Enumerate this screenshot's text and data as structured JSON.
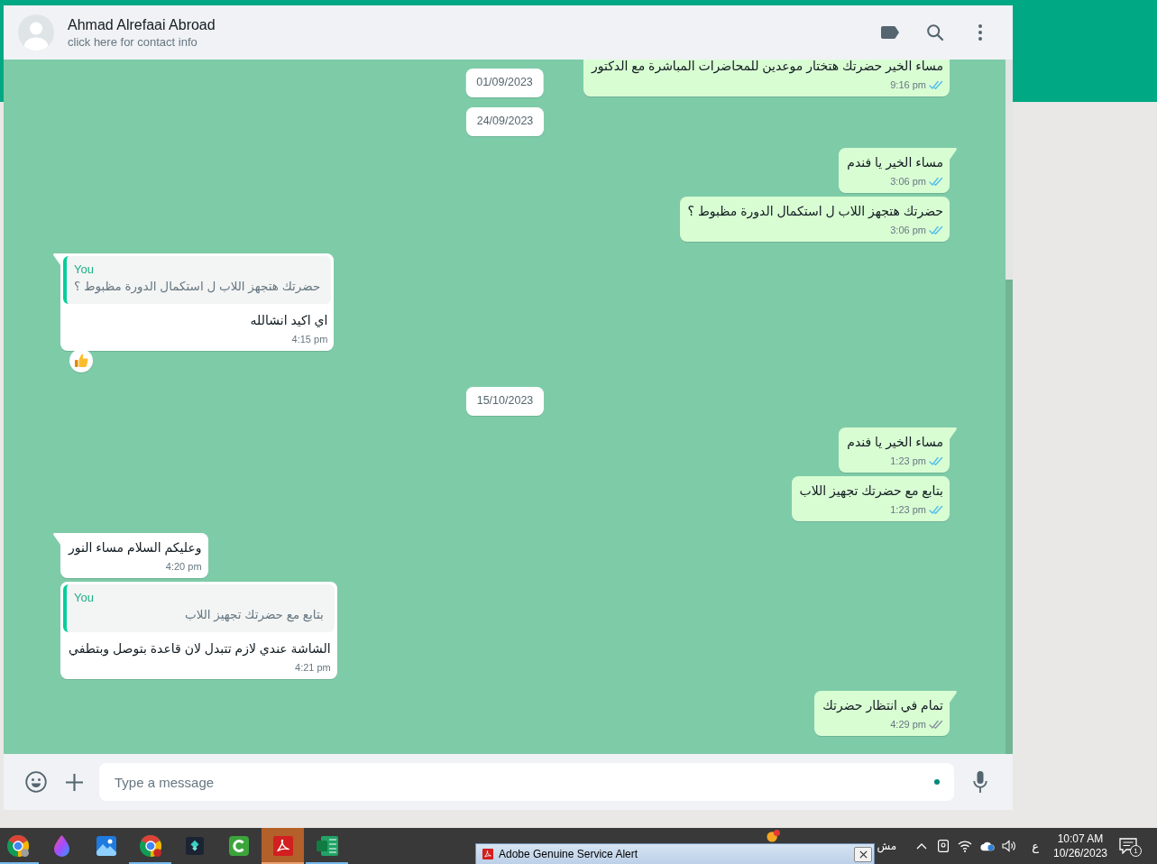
{
  "header": {
    "name": "Ahmad Alrefaai Abroad",
    "subtitle": "click here for contact info"
  },
  "chat": {
    "floating_date": "01/09/2023",
    "timeline": [
      {
        "kind": "outgoing",
        "tail": false,
        "text": "مساء الخير حضرتك هتختار موعدين للمحاضرات المباشرة مع الدكتور",
        "time": "9:16 pm",
        "read": true,
        "reaction": false
      },
      {
        "kind": "date",
        "text": "24/09/2023"
      },
      {
        "kind": "outgoing",
        "tail": true,
        "text": "مساء الخير يا فندم",
        "time": "3:06 pm",
        "read": true,
        "reaction": false
      },
      {
        "kind": "outgoing",
        "tail": false,
        "text": "حضرتك هتجهز اللاب ل استكمال الدورة مظبوط ؟",
        "time": "3:06 pm",
        "read": true,
        "reaction": false
      },
      {
        "kind": "incoming",
        "tail": true,
        "quote": {
          "author": "You",
          "text": "حضرتك هتجهز اللاب ل استكمال الدورة مظبوط ؟"
        },
        "text": "اي اكيد انشالله",
        "time": "4:15 pm",
        "reaction": true
      },
      {
        "kind": "date",
        "text": "15/10/2023"
      },
      {
        "kind": "outgoing",
        "tail": true,
        "text": "مساء الخير يا فندم",
        "time": "1:23 pm",
        "read": true,
        "reaction": false
      },
      {
        "kind": "outgoing",
        "tail": false,
        "text": "بتابع مع حضرتك تجهيز اللاب",
        "time": "1:23 pm",
        "read": true,
        "reaction": false
      },
      {
        "kind": "incoming",
        "tail": true,
        "text": "وعليكم السلام مساء النور",
        "time": "4:20 pm",
        "reaction": false
      },
      {
        "kind": "incoming",
        "tail": false,
        "quote": {
          "author": "You",
          "text": "بتابع مع حضرتك تجهيز اللاب"
        },
        "text": "الشاشة عندي لازم تتبدل لان قاعدة بتوصل وبتطفي",
        "time": "4:21 pm",
        "reaction": false
      },
      {
        "kind": "outgoing",
        "tail": true,
        "text": "تمام في انتظار حضرتك",
        "time": "4:29 pm",
        "read": false,
        "reaction": false
      }
    ]
  },
  "composer": {
    "placeholder": "Type a message"
  },
  "taskbar": {
    "apps": [
      {
        "kind": "browser",
        "running": true,
        "attention": false
      },
      {
        "kind": "drop",
        "running": false,
        "attention": false
      },
      {
        "kind": "photos",
        "running": false,
        "attention": false
      },
      {
        "kind": "browser_profile",
        "running": true,
        "attention": false
      },
      {
        "kind": "video_editor",
        "running": false,
        "attention": false
      },
      {
        "kind": "recorder",
        "running": false,
        "attention": false
      },
      {
        "kind": "pdf_reader",
        "running": true,
        "attention": true
      },
      {
        "kind": "spreadsheet",
        "running": true,
        "attention": false
      }
    ],
    "tray": {
      "weather_text": "مش",
      "language": "ع",
      "time": "10:07 AM",
      "date": "10/26/2023",
      "notification_count": "1"
    }
  },
  "alert_window": {
    "title": "Adobe Genuine Service Alert"
  }
}
